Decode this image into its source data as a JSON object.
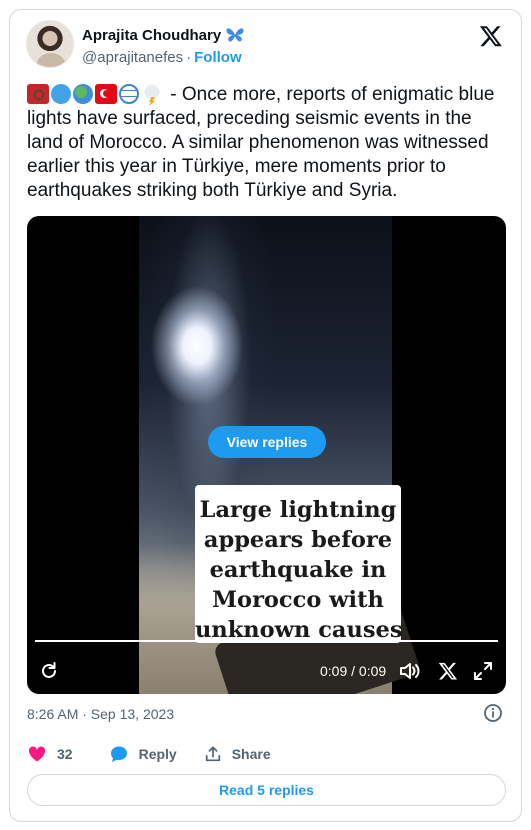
{
  "author": {
    "display_name": "Aprajita Choudhary",
    "handle": "@aprajitanefes",
    "follow_label": "Follow",
    "badge_icon": "butterfly-icon"
  },
  "tweet": {
    "emojis": [
      "morocco-flag-icon",
      "blue-circle-icon",
      "earth-globe-icon",
      "turkey-flag-icon",
      "globe-with-meridians-icon",
      "cloud-with-lightning-icon"
    ],
    "text": "- Once more, reports of enigmatic blue lights have surfaced, preceding seismic events in the land of Morocco. A similar phenomenon was witnessed earlier this year in Türkiye, mere moments prior to earthquakes striking both Türkiye and Syria."
  },
  "video": {
    "view_replies_label": "View replies",
    "caption_lines": [
      "Large lightning",
      "appears before",
      "earthquake in",
      "Morocco with",
      "unknown causes"
    ],
    "time_display": "0:09 / 0:09",
    "progress": 1.0
  },
  "meta": {
    "timestamp": "8:26 AM · Sep 13, 2023"
  },
  "actions": {
    "like_count": "32",
    "reply_label": "Reply",
    "share_label": "Share"
  },
  "read_replies_label": "Read 5 replies",
  "colors": {
    "accent": "#1d9bf0",
    "like": "#f91880",
    "text": "#0f1419",
    "secondary": "#536471",
    "border": "#cfd9de"
  }
}
